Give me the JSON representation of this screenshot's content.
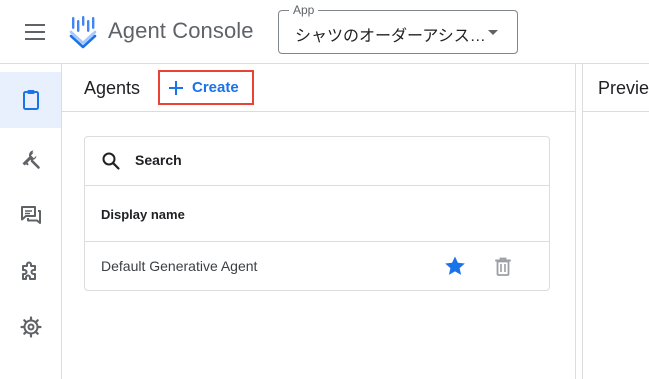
{
  "header": {
    "brand": "Agent Console",
    "app_select": {
      "legend": "App",
      "value": "シャツのオーダーアシス…"
    }
  },
  "rail": {
    "items": [
      {
        "name": "agents",
        "icon": "clipboard-icon",
        "active": true
      },
      {
        "name": "tools",
        "icon": "wrench-icon",
        "active": false
      },
      {
        "name": "conversations",
        "icon": "chat-icon",
        "active": false
      },
      {
        "name": "integrations",
        "icon": "puzzle-icon",
        "active": false
      },
      {
        "name": "settings",
        "icon": "gear-icon",
        "active": false
      }
    ]
  },
  "agents_panel": {
    "title": "Agents",
    "create_label": "Create",
    "search_label": "Search",
    "column_header": "Display name",
    "rows": [
      {
        "name": "Default Generative Agent",
        "starred": true
      }
    ]
  },
  "preview_panel": {
    "title": "Previe"
  },
  "colors": {
    "accent": "#1a73e8",
    "highlight": "#ea4335",
    "rail_active": "#e8f0fe",
    "icon": "#5f6368"
  }
}
